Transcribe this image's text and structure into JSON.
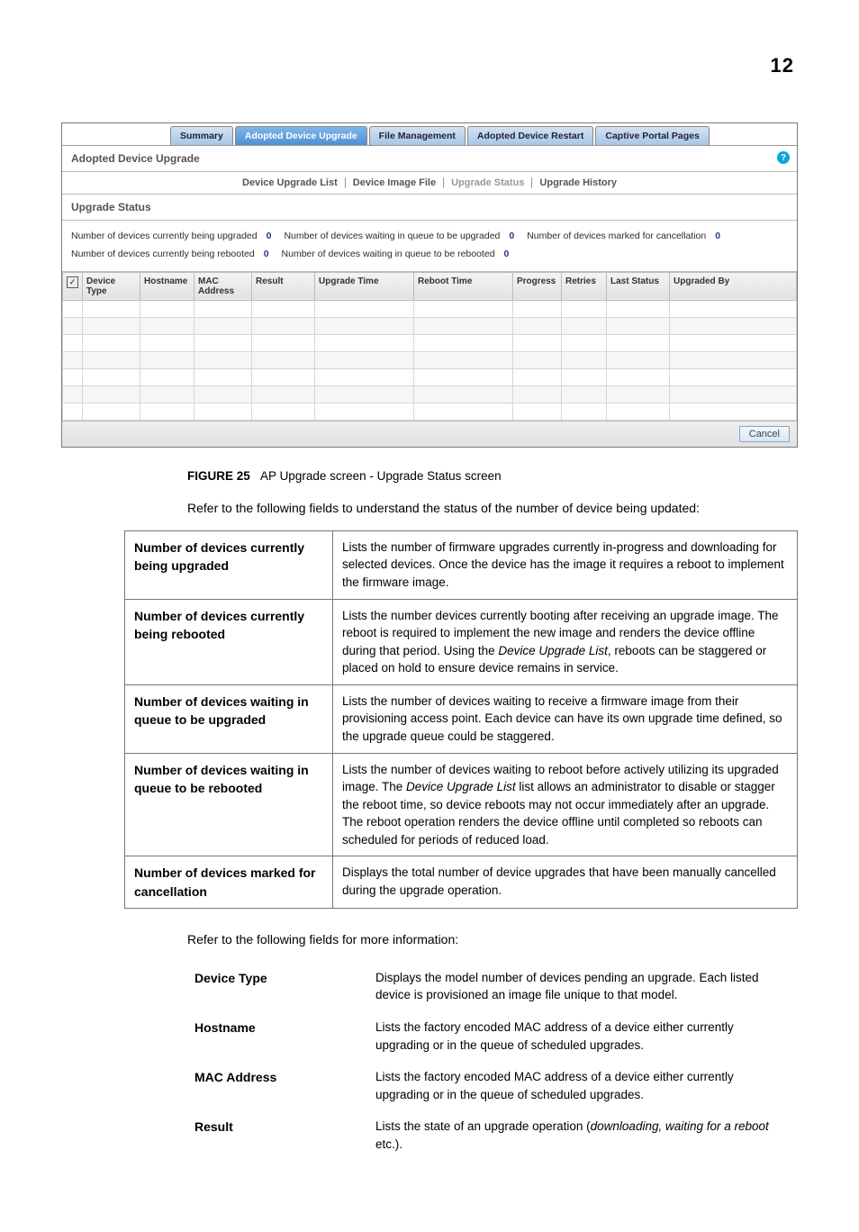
{
  "pagenum": "12",
  "maintabs": [
    "Summary",
    "Adopted Device Upgrade",
    "File Management",
    "Adopted Device Restart",
    "Captive Portal Pages"
  ],
  "section_title": "Adopted Device Upgrade",
  "subtabs": [
    "Device Upgrade List",
    "Device Image File",
    "Upgrade Status",
    "Upgrade History"
  ],
  "subsection_title": "Upgrade Status",
  "stats": [
    {
      "label": "Number of devices currently being upgraded",
      "value": "0"
    },
    {
      "label": "Number of devices waiting in queue to be upgraded",
      "value": "0"
    },
    {
      "label": "Number of devices marked for cancellation",
      "value": "0"
    },
    {
      "label": "Number of devices currently being rebooted",
      "value": "0"
    },
    {
      "label": "Number of devices waiting in queue to be rebooted",
      "value": "0"
    }
  ],
  "grid_headers": [
    "Device Type",
    "Hostname",
    "MAC Address",
    "Result",
    "Upgrade Time",
    "Reboot Time",
    "Progress",
    "Retries",
    "Last Status",
    "Upgraded By"
  ],
  "cancel_btn": "Cancel",
  "fig_label": "FIGURE 25",
  "fig_caption": "AP Upgrade screen - Upgrade Status screen",
  "intro1": "Refer to the following fields to understand the status of the number of device being updated:",
  "table1": [
    {
      "term": "Number of devices currently being upgraded",
      "desc_pre": "Lists the number of firmware upgrades currently in-progress and downloading for selected devices. Once the device has the image it requires a reboot to implement the firmware image.",
      "ital": "",
      "desc_post": ""
    },
    {
      "term": "Number of devices currently being rebooted",
      "desc_pre": "Lists the number devices currently booting after receiving an upgrade image. The reboot is required to implement the new image and renders the device offline during that period. Using the ",
      "ital": "Device Upgrade List",
      "desc_post": ", reboots can be staggered or placed on hold to ensure device remains in service."
    },
    {
      "term": "Number of devices waiting in queue to be upgraded",
      "desc_pre": "Lists the number of devices waiting to receive a firmware image from their provisioning access point. Each device can have its own upgrade time defined, so the upgrade queue could be staggered.",
      "ital": "",
      "desc_post": ""
    },
    {
      "term": "Number of devices waiting in queue to be rebooted",
      "desc_pre": "Lists the number of devices waiting to reboot before actively utilizing its upgraded image. The ",
      "ital": "Device Upgrade List",
      "desc_post": " list allows an administrator to disable or stagger the reboot time, so device reboots may not occur immediately after an upgrade. The reboot operation renders the device offline until completed so reboots can scheduled for periods of reduced load."
    },
    {
      "term": "Number of devices marked for cancellation",
      "desc_pre": "Displays the total number of device upgrades that have been manually cancelled during the upgrade operation.",
      "ital": "",
      "desc_post": ""
    }
  ],
  "intro2": "Refer to the following fields for more information:",
  "table2": [
    {
      "term": "Device Type",
      "desc_pre": "Displays the model number of devices pending an upgrade. Each listed device is provisioned an image file unique to that model.",
      "ital": "",
      "desc_post": ""
    },
    {
      "term": "Hostname",
      "desc_pre": "Lists the factory encoded MAC address of a device either currently upgrading or in the queue of scheduled upgrades.",
      "ital": "",
      "desc_post": ""
    },
    {
      "term": "MAC Address",
      "desc_pre": "Lists the factory encoded MAC address of a device either currently upgrading or in the queue of scheduled upgrades.",
      "ital": "",
      "desc_post": ""
    },
    {
      "term": "Result",
      "desc_pre": "Lists the state of an upgrade operation (",
      "ital": "downloading, waiting for a reboot",
      "desc_post": " etc.)."
    }
  ]
}
